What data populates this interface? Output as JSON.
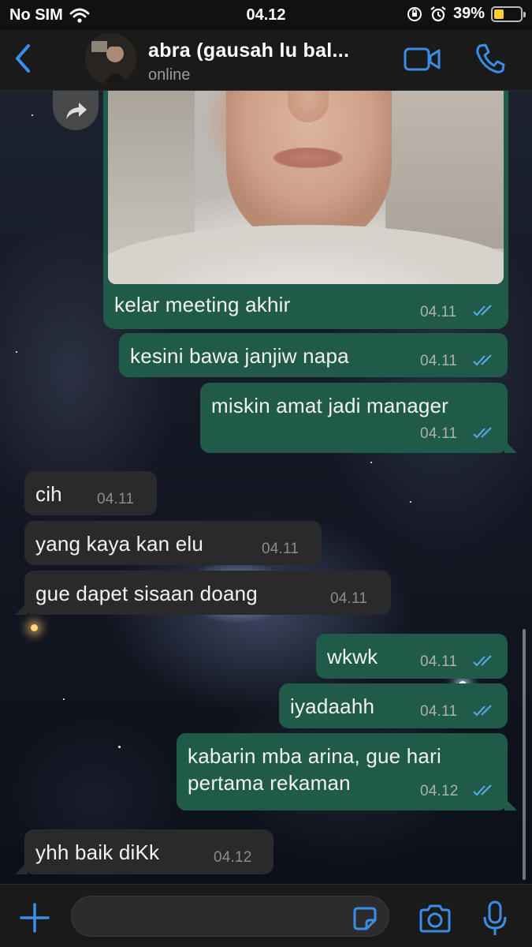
{
  "status_bar": {
    "carrier": "No SIM",
    "time": "04.12",
    "battery": "39%",
    "battery_level": 0.39,
    "icons": [
      "wifi-icon",
      "orientation-lock-icon",
      "alarm-icon",
      "battery-icon"
    ]
  },
  "header": {
    "contact_name": "abra (gausah lu bal...",
    "contact_status": "online",
    "icons": [
      "back-chevron-icon",
      "video-call-icon",
      "phone-call-icon"
    ]
  },
  "photo_message": {
    "caption": "kelar meeting akhir",
    "time": "04.11",
    "read": true
  },
  "messages": [
    {
      "direction": "out",
      "text": "kesini bawa janjiw napa",
      "time": "04.11",
      "read": true
    },
    {
      "direction": "out",
      "text": "miskin amat jadi manager",
      "time": "04.11",
      "read": true
    },
    {
      "direction": "in",
      "text": "cih",
      "time": "04.11"
    },
    {
      "direction": "in",
      "text": "yang kaya kan elu",
      "time": "04.11"
    },
    {
      "direction": "in",
      "text": "gue dapet sisaan doang",
      "time": "04.11"
    },
    {
      "direction": "out",
      "text": "wkwk",
      "time": "04.11",
      "read": true
    },
    {
      "direction": "out",
      "text": "iyadaahh",
      "time": "04.11",
      "read": true
    },
    {
      "direction": "out",
      "text": "kabarin mba arina, gue hari\npertama rekaman",
      "time": "04.12",
      "read": true
    },
    {
      "direction": "in",
      "text": "yhh baik diKk",
      "time": "04.12"
    }
  ],
  "composer": {
    "placeholder": "",
    "icons": [
      "plus-icon",
      "sticker-icon",
      "camera-icon",
      "microphone-icon"
    ]
  },
  "colors": {
    "accent": "#3a8ee6",
    "outgoing_bubble": "#1f5b48",
    "incoming_bubble": "#2a2a2c",
    "read_tick": "#5aa8f0"
  }
}
